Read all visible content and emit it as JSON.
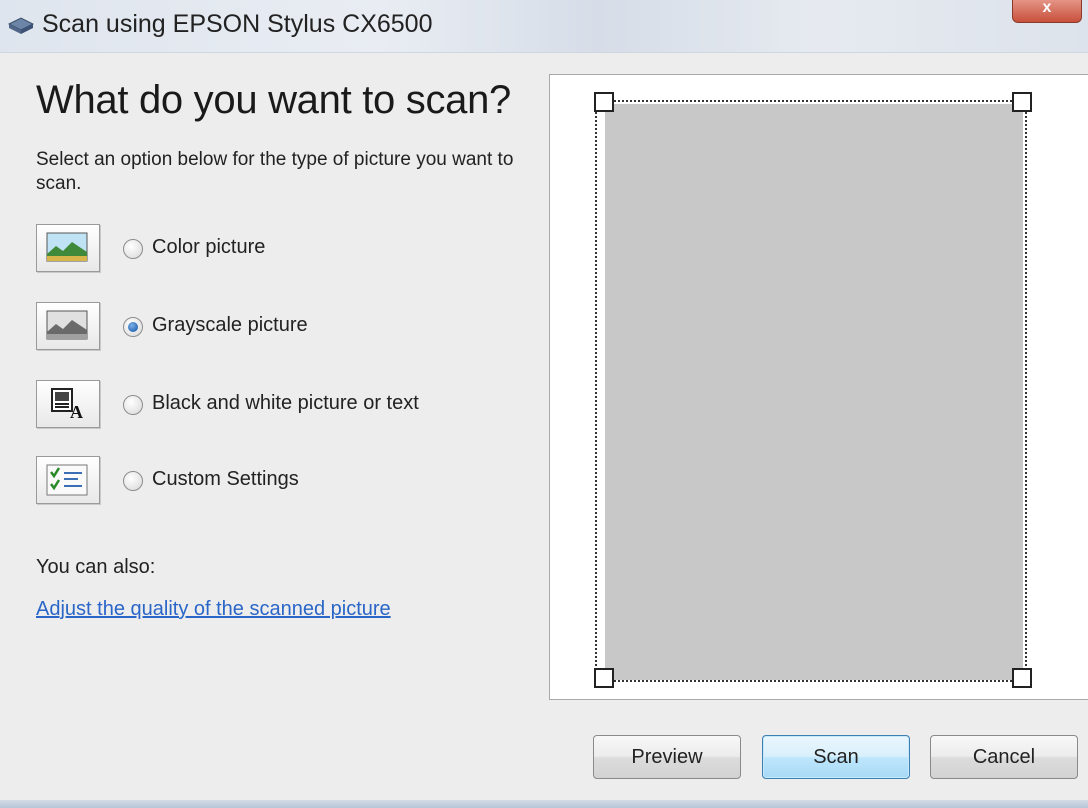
{
  "window": {
    "title": "Scan using EPSON Stylus CX6500",
    "close_label": "x"
  },
  "main": {
    "heading": "What do you want to scan?",
    "subtitle": "Select an option below for the type of picture you want to scan.",
    "options": [
      {
        "label": "Color picture",
        "icon": "color-picture-icon",
        "selected": false
      },
      {
        "label": "Grayscale picture",
        "icon": "grayscale-picture-icon",
        "selected": true
      },
      {
        "label": "Black and white picture or text",
        "icon": "black-white-text-icon",
        "selected": false
      },
      {
        "label": "Custom Settings",
        "icon": "custom-settings-icon",
        "selected": false
      }
    ],
    "also_label": "You can also:",
    "adjust_link": "Adjust the quality of the scanned picture"
  },
  "preview": {
    "scan_area_color": "#c8c8c8"
  },
  "buttons": {
    "preview": "Preview",
    "scan": "Scan",
    "cancel": "Cancel"
  }
}
